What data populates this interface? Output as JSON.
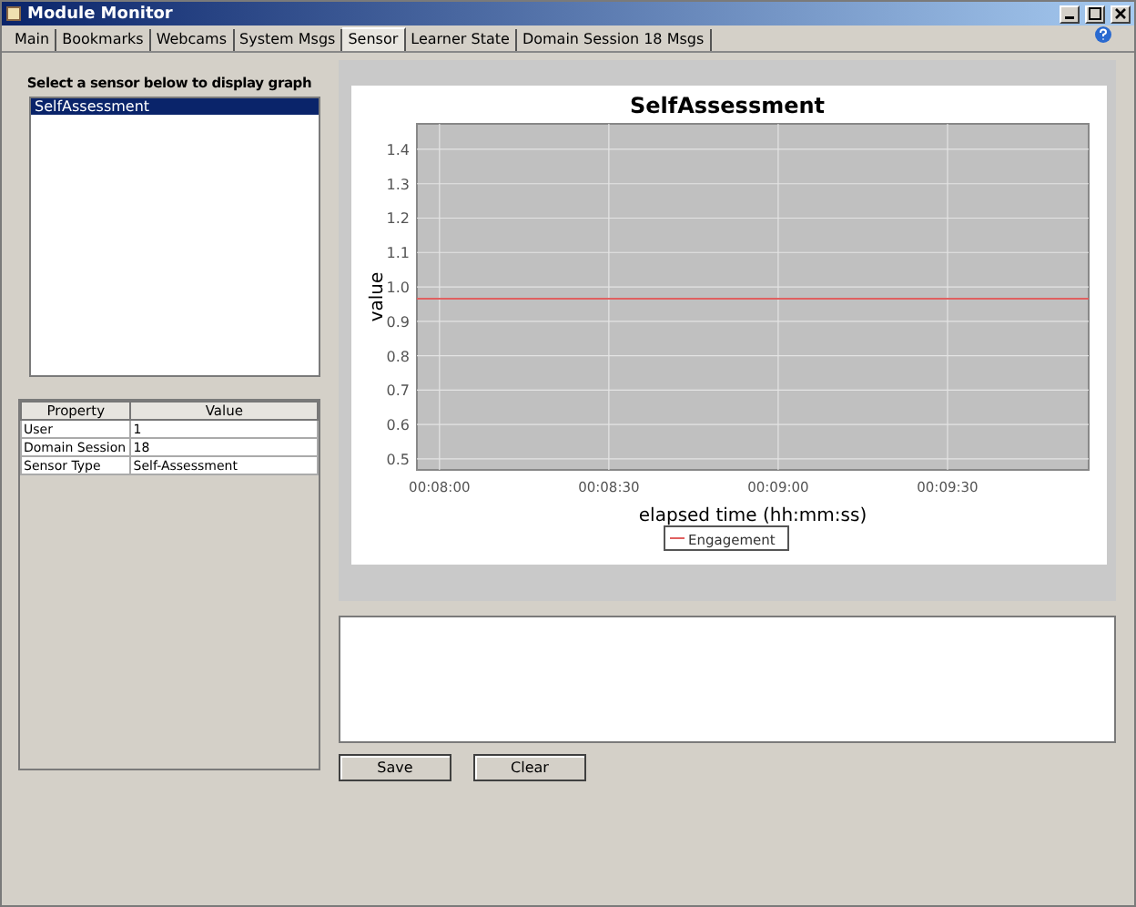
{
  "window": {
    "title": "Module Monitor"
  },
  "tabs": [
    {
      "label": "Main",
      "selected": false
    },
    {
      "label": "Bookmarks",
      "selected": false
    },
    {
      "label": "Webcams",
      "selected": false
    },
    {
      "label": "System Msgs",
      "selected": false
    },
    {
      "label": "Sensor",
      "selected": true
    },
    {
      "label": "Learner State",
      "selected": false
    },
    {
      "label": "Domain Session 18 Msgs",
      "selected": false
    }
  ],
  "sensor_list": {
    "heading": "Select a sensor below to display graph",
    "items": [
      {
        "label": "SelfAssessment",
        "selected": true
      }
    ]
  },
  "property_table": {
    "columns": [
      "Property",
      "Value"
    ],
    "rows": [
      [
        "User",
        "1"
      ],
      [
        "Domain Session",
        "18"
      ],
      [
        "Sensor Type",
        "Self-Assessment"
      ]
    ]
  },
  "chart_data": {
    "type": "line",
    "grid": true,
    "title": "SelfAssessment",
    "xlabel": "elapsed time (hh:mm:ss)",
    "ylabel": "value",
    "x": [
      476,
      595
    ],
    "series": [
      {
        "name": "Engagement",
        "color": "#e06060",
        "values": [
          0.966,
          0.966
        ]
      }
    ],
    "xlim": [
      476,
      595
    ],
    "ylim": [
      0.468,
      1.474
    ],
    "xticks": [
      {
        "value": 480,
        "label": "00:08:00"
      },
      {
        "value": 510,
        "label": "00:08:30"
      },
      {
        "value": 540,
        "label": "00:09:00"
      },
      {
        "value": 570,
        "label": "00:09:30"
      }
    ],
    "yticks": [
      {
        "value": 0.5,
        "label": "0.5"
      },
      {
        "value": 0.6,
        "label": "0.6"
      },
      {
        "value": 0.7,
        "label": "0.7"
      },
      {
        "value": 0.8,
        "label": "0.8"
      },
      {
        "value": 0.9,
        "label": "0.9"
      },
      {
        "value": 1.0,
        "label": "1.0"
      },
      {
        "value": 1.1,
        "label": "1.1"
      },
      {
        "value": 1.2,
        "label": "1.2"
      },
      {
        "value": 1.3,
        "label": "1.3"
      },
      {
        "value": 1.4,
        "label": "1.4"
      }
    ]
  },
  "buttons": [
    "Save",
    "Clear"
  ]
}
